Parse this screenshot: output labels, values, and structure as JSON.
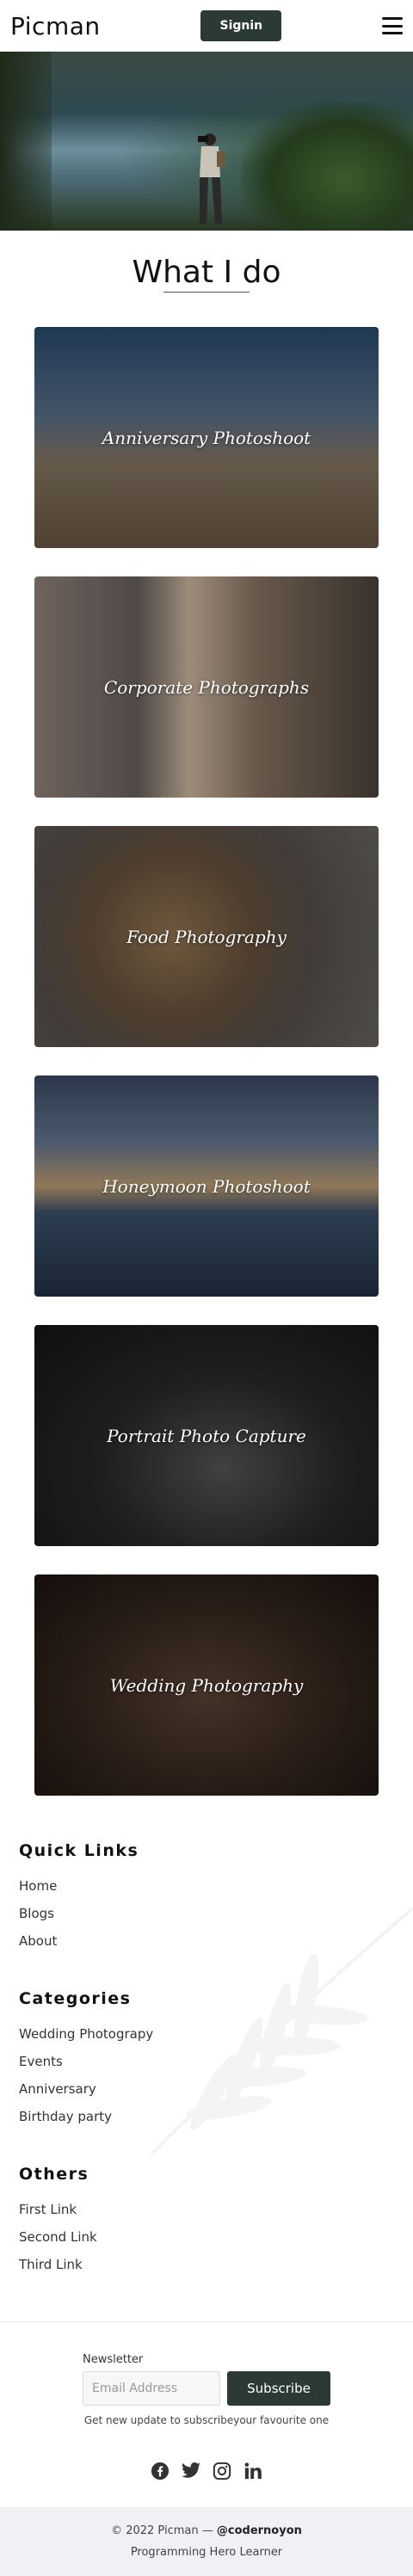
{
  "navbar": {
    "brand": "Picman",
    "signin_label": "Signin"
  },
  "services": {
    "title": "What I do",
    "items": [
      {
        "label": "Anniversary Photoshoot"
      },
      {
        "label": "Corporate Photographs"
      },
      {
        "label": "Food Photography"
      },
      {
        "label": "Honeymoon Photoshoot"
      },
      {
        "label": "Portrait Photo Capture"
      },
      {
        "label": "Wedding Photography"
      }
    ]
  },
  "footer": {
    "quick_links": {
      "title": "Quick Links",
      "items": [
        "Home",
        "Blogs",
        "About"
      ]
    },
    "categories": {
      "title": "Categories",
      "items": [
        "Wedding Photograpy",
        "Events",
        "Anniversary",
        "Birthday party"
      ]
    },
    "others": {
      "title": "Others",
      "items": [
        "First Link",
        "Second Link",
        "Third Link"
      ]
    }
  },
  "newsletter": {
    "label": "Newsletter",
    "placeholder": "Email Address",
    "button": "Subscribe",
    "note": "Get new update to subscribeyour favourite one"
  },
  "socials": [
    "facebook-icon",
    "twitter-icon",
    "instagram-icon",
    "linkedin-icon"
  ],
  "bottom": {
    "copyright_prefix": "© 2022 Picman — ",
    "author": "@codernoyon",
    "learner": "Programming Hero Learner"
  },
  "colors": {
    "accent": "#2b3a36",
    "bottom_bar": "#f0f1f4"
  }
}
